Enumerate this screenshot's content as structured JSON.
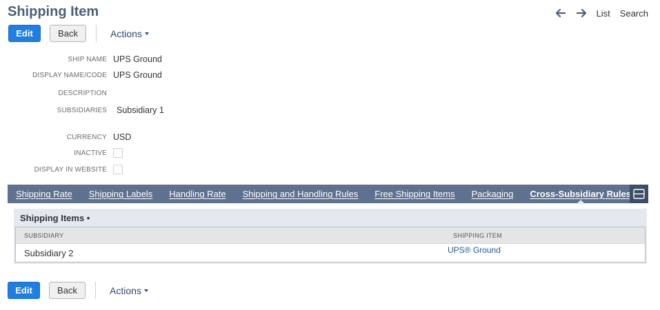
{
  "page": {
    "title": "Shipping Item"
  },
  "nav": {
    "prev_icon": "arrow-left-icon",
    "next_icon": "arrow-right-icon",
    "list_label": "List",
    "search_label": "Search"
  },
  "toolbar": {
    "edit_label": "Edit",
    "back_label": "Back",
    "actions_label": "Actions"
  },
  "fields": [
    {
      "label": "SHIP NAME",
      "value": "UPS Ground"
    },
    {
      "label": "DISPLAY NAME/CODE",
      "value": "UPS Ground"
    },
    {
      "label": "DESCRIPTION",
      "value": ""
    },
    {
      "label": "SUBSIDIARIES",
      "value": "Subsidiary 1"
    },
    {
      "label": "CURRENCY",
      "value": "USD"
    },
    {
      "label": "INACTIVE",
      "checked": false
    },
    {
      "label": "DISPLAY IN WEBSITE",
      "checked": false
    }
  ],
  "tabs": [
    {
      "label": "Shipping Rate"
    },
    {
      "label": "Shipping Labels"
    },
    {
      "label": "Handling Rate"
    },
    {
      "label": "Shipping and Handling Rules"
    },
    {
      "label": "Free Shipping Items"
    },
    {
      "label": "Packaging"
    },
    {
      "label": "Cross-Subsidiary Rules",
      "active": true
    }
  ],
  "subtab": {
    "title": "Shipping Items •",
    "columns": [
      "SUBSIDIARY",
      "SHIPPING ITEM"
    ],
    "rows": [
      {
        "subsidiary": "Subsidiary 2",
        "shipping_item": "UPS® Ground"
      }
    ]
  },
  "colors": {
    "primary_button": "#1f7ee0",
    "tab_bar": "#5e718f",
    "title": "#4d5f79",
    "link": "#255599"
  }
}
